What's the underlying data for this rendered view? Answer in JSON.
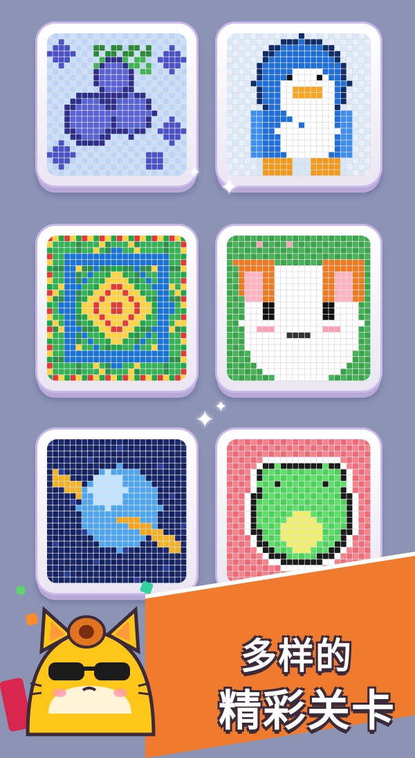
{
  "banner": {
    "line1": "多样的",
    "line2": "精彩关卡"
  },
  "levels": [
    {
      "name": "blueberries"
    },
    {
      "name": "penguin"
    },
    {
      "name": "mosaic"
    },
    {
      "name": "cat"
    },
    {
      "name": "planet"
    },
    {
      "name": "frog"
    }
  ],
  "colors": {
    "background": "#8c94b6",
    "banner": "#f07b2e",
    "tile_border": "#cbb8ea"
  },
  "icons": [
    "sparkle-icon",
    "cat-mascot-icon",
    "sunglasses-icon",
    "cube-icon"
  ]
}
